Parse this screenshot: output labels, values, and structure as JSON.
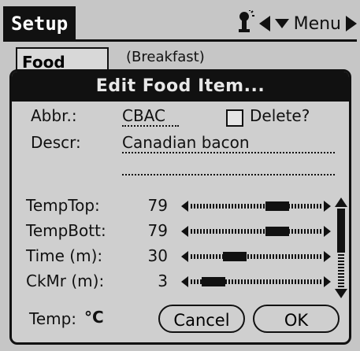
{
  "app": {
    "title": "Setup"
  },
  "topbar": {
    "menu_label": "Menu"
  },
  "background_form": {
    "category": "Food",
    "description": "(Breakfast)"
  },
  "dialog": {
    "title": "Edit Food Item...",
    "abbr_label": "Abbr.:",
    "abbr_value": "CBAC",
    "delete_label": "Delete?",
    "delete_checked": false,
    "descr_label": "Descr:",
    "descr_value": "Canadian bacon",
    "descr_line2": "",
    "settings": [
      {
        "label": "TempTop:",
        "value": "79",
        "level": 0.7
      },
      {
        "label": "TempBott:",
        "value": "79",
        "level": 0.7
      },
      {
        "label": "Time (m):",
        "value": "30",
        "level": 0.3
      },
      {
        "label": "CkMr (m):",
        "value": "3",
        "level": 0.1
      }
    ],
    "temp_label": "Temp:",
    "temp_unit": "°C",
    "cancel_label": "Cancel",
    "ok_label": "OK",
    "icons": [
      "wrench-sparkle-icon",
      "left-arrow-icon",
      "down-arrow-icon",
      "right-arrow-icon",
      "scroll-up-icon",
      "scroll-down-icon"
    ]
  }
}
